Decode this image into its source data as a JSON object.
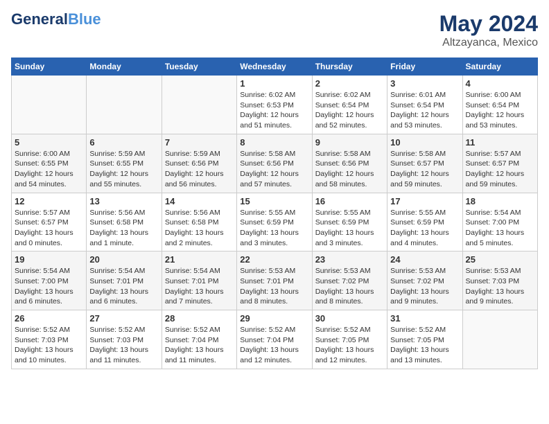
{
  "logo": {
    "line1": "General",
    "line2": "Blue"
  },
  "header": {
    "month": "May 2024",
    "location": "Altzayanca, Mexico"
  },
  "weekdays": [
    "Sunday",
    "Monday",
    "Tuesday",
    "Wednesday",
    "Thursday",
    "Friday",
    "Saturday"
  ],
  "weeks": [
    [
      {
        "day": "",
        "sunrise": "",
        "sunset": "",
        "daylight": ""
      },
      {
        "day": "",
        "sunrise": "",
        "sunset": "",
        "daylight": ""
      },
      {
        "day": "",
        "sunrise": "",
        "sunset": "",
        "daylight": ""
      },
      {
        "day": "1",
        "sunrise": "Sunrise: 6:02 AM",
        "sunset": "Sunset: 6:53 PM",
        "daylight": "Daylight: 12 hours and 51 minutes."
      },
      {
        "day": "2",
        "sunrise": "Sunrise: 6:02 AM",
        "sunset": "Sunset: 6:54 PM",
        "daylight": "Daylight: 12 hours and 52 minutes."
      },
      {
        "day": "3",
        "sunrise": "Sunrise: 6:01 AM",
        "sunset": "Sunset: 6:54 PM",
        "daylight": "Daylight: 12 hours and 53 minutes."
      },
      {
        "day": "4",
        "sunrise": "Sunrise: 6:00 AM",
        "sunset": "Sunset: 6:54 PM",
        "daylight": "Daylight: 12 hours and 53 minutes."
      }
    ],
    [
      {
        "day": "5",
        "sunrise": "Sunrise: 6:00 AM",
        "sunset": "Sunset: 6:55 PM",
        "daylight": "Daylight: 12 hours and 54 minutes."
      },
      {
        "day": "6",
        "sunrise": "Sunrise: 5:59 AM",
        "sunset": "Sunset: 6:55 PM",
        "daylight": "Daylight: 12 hours and 55 minutes."
      },
      {
        "day": "7",
        "sunrise": "Sunrise: 5:59 AM",
        "sunset": "Sunset: 6:56 PM",
        "daylight": "Daylight: 12 hours and 56 minutes."
      },
      {
        "day": "8",
        "sunrise": "Sunrise: 5:58 AM",
        "sunset": "Sunset: 6:56 PM",
        "daylight": "Daylight: 12 hours and 57 minutes."
      },
      {
        "day": "9",
        "sunrise": "Sunrise: 5:58 AM",
        "sunset": "Sunset: 6:56 PM",
        "daylight": "Daylight: 12 hours and 58 minutes."
      },
      {
        "day": "10",
        "sunrise": "Sunrise: 5:58 AM",
        "sunset": "Sunset: 6:57 PM",
        "daylight": "Daylight: 12 hours and 59 minutes."
      },
      {
        "day": "11",
        "sunrise": "Sunrise: 5:57 AM",
        "sunset": "Sunset: 6:57 PM",
        "daylight": "Daylight: 12 hours and 59 minutes."
      }
    ],
    [
      {
        "day": "12",
        "sunrise": "Sunrise: 5:57 AM",
        "sunset": "Sunset: 6:57 PM",
        "daylight": "Daylight: 13 hours and 0 minutes."
      },
      {
        "day": "13",
        "sunrise": "Sunrise: 5:56 AM",
        "sunset": "Sunset: 6:58 PM",
        "daylight": "Daylight: 13 hours and 1 minute."
      },
      {
        "day": "14",
        "sunrise": "Sunrise: 5:56 AM",
        "sunset": "Sunset: 6:58 PM",
        "daylight": "Daylight: 13 hours and 2 minutes."
      },
      {
        "day": "15",
        "sunrise": "Sunrise: 5:55 AM",
        "sunset": "Sunset: 6:59 PM",
        "daylight": "Daylight: 13 hours and 3 minutes."
      },
      {
        "day": "16",
        "sunrise": "Sunrise: 5:55 AM",
        "sunset": "Sunset: 6:59 PM",
        "daylight": "Daylight: 13 hours and 3 minutes."
      },
      {
        "day": "17",
        "sunrise": "Sunrise: 5:55 AM",
        "sunset": "Sunset: 6:59 PM",
        "daylight": "Daylight: 13 hours and 4 minutes."
      },
      {
        "day": "18",
        "sunrise": "Sunrise: 5:54 AM",
        "sunset": "Sunset: 7:00 PM",
        "daylight": "Daylight: 13 hours and 5 minutes."
      }
    ],
    [
      {
        "day": "19",
        "sunrise": "Sunrise: 5:54 AM",
        "sunset": "Sunset: 7:00 PM",
        "daylight": "Daylight: 13 hours and 6 minutes."
      },
      {
        "day": "20",
        "sunrise": "Sunrise: 5:54 AM",
        "sunset": "Sunset: 7:01 PM",
        "daylight": "Daylight: 13 hours and 6 minutes."
      },
      {
        "day": "21",
        "sunrise": "Sunrise: 5:54 AM",
        "sunset": "Sunset: 7:01 PM",
        "daylight": "Daylight: 13 hours and 7 minutes."
      },
      {
        "day": "22",
        "sunrise": "Sunrise: 5:53 AM",
        "sunset": "Sunset: 7:01 PM",
        "daylight": "Daylight: 13 hours and 8 minutes."
      },
      {
        "day": "23",
        "sunrise": "Sunrise: 5:53 AM",
        "sunset": "Sunset: 7:02 PM",
        "daylight": "Daylight: 13 hours and 8 minutes."
      },
      {
        "day": "24",
        "sunrise": "Sunrise: 5:53 AM",
        "sunset": "Sunset: 7:02 PM",
        "daylight": "Daylight: 13 hours and 9 minutes."
      },
      {
        "day": "25",
        "sunrise": "Sunrise: 5:53 AM",
        "sunset": "Sunset: 7:03 PM",
        "daylight": "Daylight: 13 hours and 9 minutes."
      }
    ],
    [
      {
        "day": "26",
        "sunrise": "Sunrise: 5:52 AM",
        "sunset": "Sunset: 7:03 PM",
        "daylight": "Daylight: 13 hours and 10 minutes."
      },
      {
        "day": "27",
        "sunrise": "Sunrise: 5:52 AM",
        "sunset": "Sunset: 7:03 PM",
        "daylight": "Daylight: 13 hours and 11 minutes."
      },
      {
        "day": "28",
        "sunrise": "Sunrise: 5:52 AM",
        "sunset": "Sunset: 7:04 PM",
        "daylight": "Daylight: 13 hours and 11 minutes."
      },
      {
        "day": "29",
        "sunrise": "Sunrise: 5:52 AM",
        "sunset": "Sunset: 7:04 PM",
        "daylight": "Daylight: 13 hours and 12 minutes."
      },
      {
        "day": "30",
        "sunrise": "Sunrise: 5:52 AM",
        "sunset": "Sunset: 7:05 PM",
        "daylight": "Daylight: 13 hours and 12 minutes."
      },
      {
        "day": "31",
        "sunrise": "Sunrise: 5:52 AM",
        "sunset": "Sunset: 7:05 PM",
        "daylight": "Daylight: 13 hours and 13 minutes."
      },
      {
        "day": "",
        "sunrise": "",
        "sunset": "",
        "daylight": ""
      }
    ]
  ]
}
